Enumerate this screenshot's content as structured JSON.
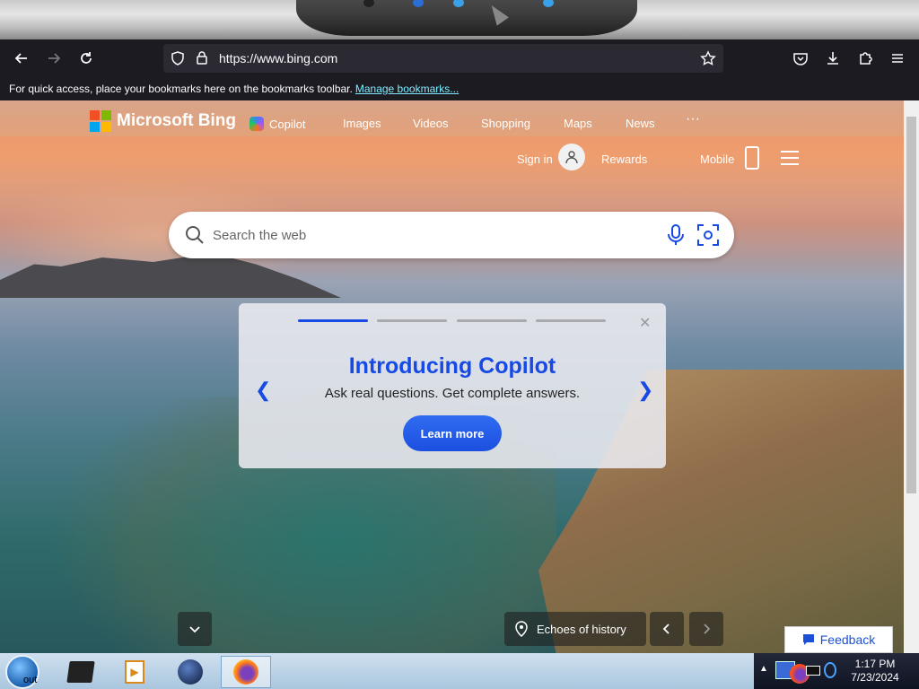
{
  "browser": {
    "url": "https://www.bing.com",
    "bookmarks_text": "For quick access, place your bookmarks here on the bookmarks toolbar.",
    "bookmarks_link": "Manage bookmarks..."
  },
  "bing": {
    "brand": "Microsoft Bing",
    "nav": [
      "Copilot",
      "Images",
      "Videos",
      "Shopping",
      "Maps",
      "News",
      "···"
    ],
    "sign_in": "Sign in",
    "rewards": "Rewards",
    "mobile": "Mobile",
    "search_placeholder": "Search the web"
  },
  "card": {
    "title": "Introducing Copilot",
    "subtitle": "Ask real questions. Get complete answers.",
    "button": "Learn more"
  },
  "bottom": {
    "caption": "Echoes of history",
    "feedback": "Feedback"
  },
  "taskbar": {
    "time": "1:17 PM",
    "date": "7/23/2024",
    "desktop_label": "out"
  },
  "colors": {
    "accent": "#174ae4",
    "toolbar_bg": "#1c1b22",
    "link": "#80ebff"
  }
}
